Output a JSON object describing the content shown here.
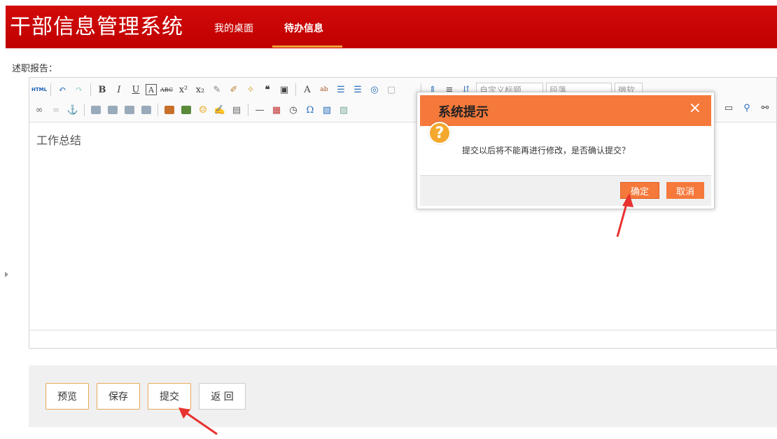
{
  "header": {
    "app_title": "干部信息管理系统",
    "nav": [
      {
        "label": "我的桌面"
      },
      {
        "label": "待办信息"
      }
    ]
  },
  "section_label": "述职报告：",
  "editor": {
    "toolbar": {
      "html_label": "HTML",
      "heading_select": "自定义标题",
      "paragraph_select": "段落",
      "font_select": "微软"
    },
    "content": "工作总结"
  },
  "actions": {
    "preview": "预览",
    "save": "保存",
    "submit": "提交",
    "back": "返 回"
  },
  "dialog": {
    "title": "系统提示",
    "close": "×",
    "message": "提交以后将不能再进行修改，是否确认提交？",
    "confirm": "确定",
    "cancel": "取消",
    "icon_char": "?"
  },
  "colors": {
    "header_red": "#c00000",
    "accent_orange": "#f5793b",
    "nav_underline": "#f2a33a",
    "annotation_arrow": "#e8322f"
  }
}
